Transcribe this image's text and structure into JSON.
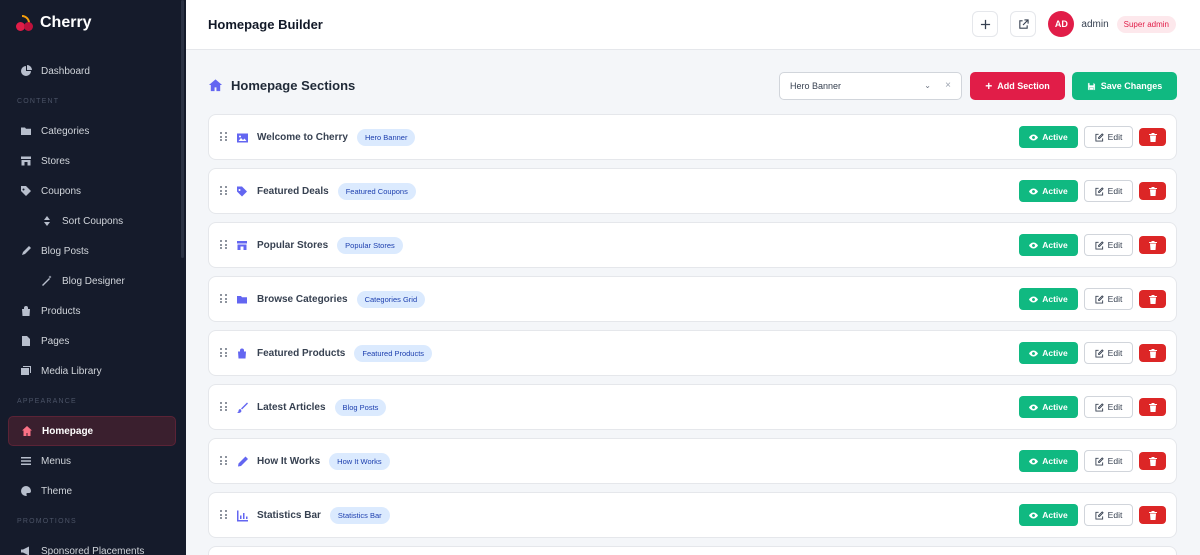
{
  "brand": {
    "name": "Cherry"
  },
  "sidebar": {
    "items": [
      {
        "type": "item",
        "label": "Dashboard",
        "icon": "dashboard-icon"
      },
      {
        "type": "section",
        "label": "CONTENT"
      },
      {
        "type": "item",
        "label": "Categories",
        "icon": "folder-icon"
      },
      {
        "type": "item",
        "label": "Stores",
        "icon": "store-icon"
      },
      {
        "type": "item",
        "label": "Coupons",
        "icon": "tag-icon"
      },
      {
        "type": "sub",
        "label": "Sort Coupons",
        "icon": "sort-icon"
      },
      {
        "type": "item",
        "label": "Blog Posts",
        "icon": "pen-icon"
      },
      {
        "type": "sub",
        "label": "Blog Designer",
        "icon": "magic-wand-icon"
      },
      {
        "type": "item",
        "label": "Products",
        "icon": "shopping-bag-icon"
      },
      {
        "type": "item",
        "label": "Pages",
        "icon": "page-icon"
      },
      {
        "type": "item",
        "label": "Media Library",
        "icon": "images-icon"
      },
      {
        "type": "section",
        "label": "APPEARANCE"
      },
      {
        "type": "item",
        "label": "Homepage",
        "icon": "home-icon",
        "active": true
      },
      {
        "type": "item",
        "label": "Menus",
        "icon": "menu-icon"
      },
      {
        "type": "item",
        "label": "Theme",
        "icon": "palette-icon"
      },
      {
        "type": "section",
        "label": "PROMOTIONS"
      },
      {
        "type": "item",
        "label": "Sponsored Placements",
        "icon": "megaphone-icon"
      }
    ]
  },
  "header": {
    "title": "Homepage Builder",
    "user": {
      "initials": "AD",
      "name": "admin",
      "role": "Super admin"
    }
  },
  "main": {
    "title": "Homepage Sections",
    "section_select": {
      "value": "Hero Banner",
      "clear": "×"
    },
    "add_label": "Add Section",
    "save_label": "Save Changes",
    "active_label": "Active",
    "edit_label": "Edit",
    "sections": [
      {
        "title": "Welcome to Cherry",
        "type": "Hero Banner",
        "icon": "image-icon"
      },
      {
        "title": "Featured Deals",
        "type": "Featured Coupons",
        "icon": "tags-icon"
      },
      {
        "title": "Popular Stores",
        "type": "Popular Stores",
        "icon": "store-icon"
      },
      {
        "title": "Browse Categories",
        "type": "Categories Grid",
        "icon": "folder-icon"
      },
      {
        "title": "Featured Products",
        "type": "Featured Products",
        "icon": "shopping-bag-icon"
      },
      {
        "title": "Latest Articles",
        "type": "Blog Posts",
        "icon": "brush-icon"
      },
      {
        "title": "How It Works",
        "type": "How It Works",
        "icon": "pencil-icon"
      },
      {
        "title": "Statistics Bar",
        "type": "Statistics Bar",
        "icon": "bar-chart-icon"
      }
    ]
  },
  "colors": {
    "accent": "#e11d48",
    "success": "#10b981",
    "danger": "#dc2626",
    "icon": "#6366f1",
    "sidebar": "#151b2b"
  }
}
